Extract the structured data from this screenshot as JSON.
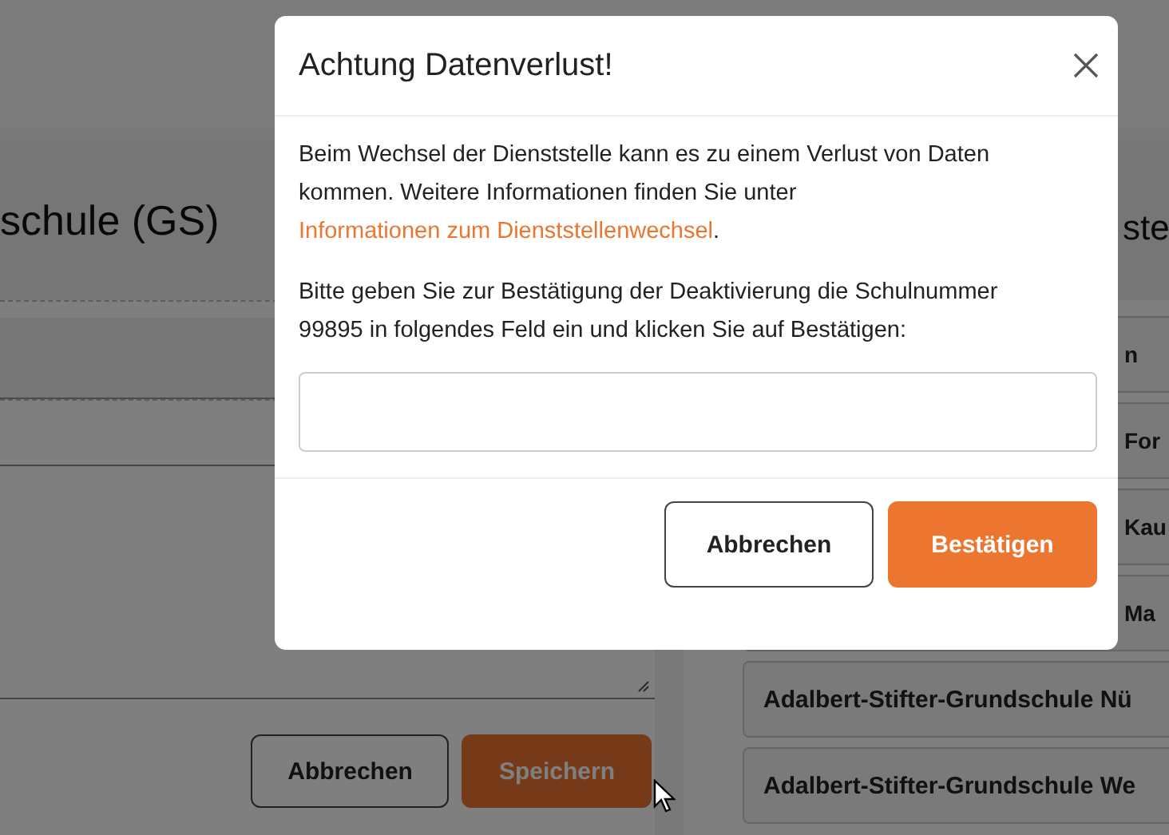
{
  "page": {
    "left_panel": {
      "heading": "schule (GS)",
      "buttons": [
        {
          "label": "Abbrechen",
          "kind": "secondary"
        },
        {
          "label": "Speichern",
          "kind": "primary"
        }
      ]
    },
    "right_panel": {
      "heading": "ste",
      "items": [
        {
          "label": "n",
          "kind": "clipped"
        },
        {
          "label": "For",
          "kind": "clipped"
        },
        {
          "label": "Kau",
          "kind": "clipped"
        },
        {
          "label": "Ma",
          "kind": "clipped"
        },
        {
          "label": "Adalbert-Stifter-Grundschule Nü",
          "kind": "full"
        },
        {
          "label": "Adalbert-Stifter-Grundschule We",
          "kind": "full"
        }
      ]
    }
  },
  "dialog": {
    "title": "Achtung Datenverlust!",
    "intro": "Beim Wechsel der Dienststelle kann es zu einem Verlust von Daten kommen. Weitere Informationen finden Sie unter",
    "link": "Informationen zum Dienststellenwechsel",
    "link_suffix": ".",
    "instruction": "Bitte geben Sie zur Bestätigung der Deaktivierung die Schulnummer 99895 in folgendes Feld ein und klicken Sie auf Bestätigen:",
    "buttons": [
      {
        "label": "Abbrechen",
        "kind": "secondary"
      },
      {
        "label": "Bestätigen",
        "kind": "primary"
      }
    ]
  }
}
